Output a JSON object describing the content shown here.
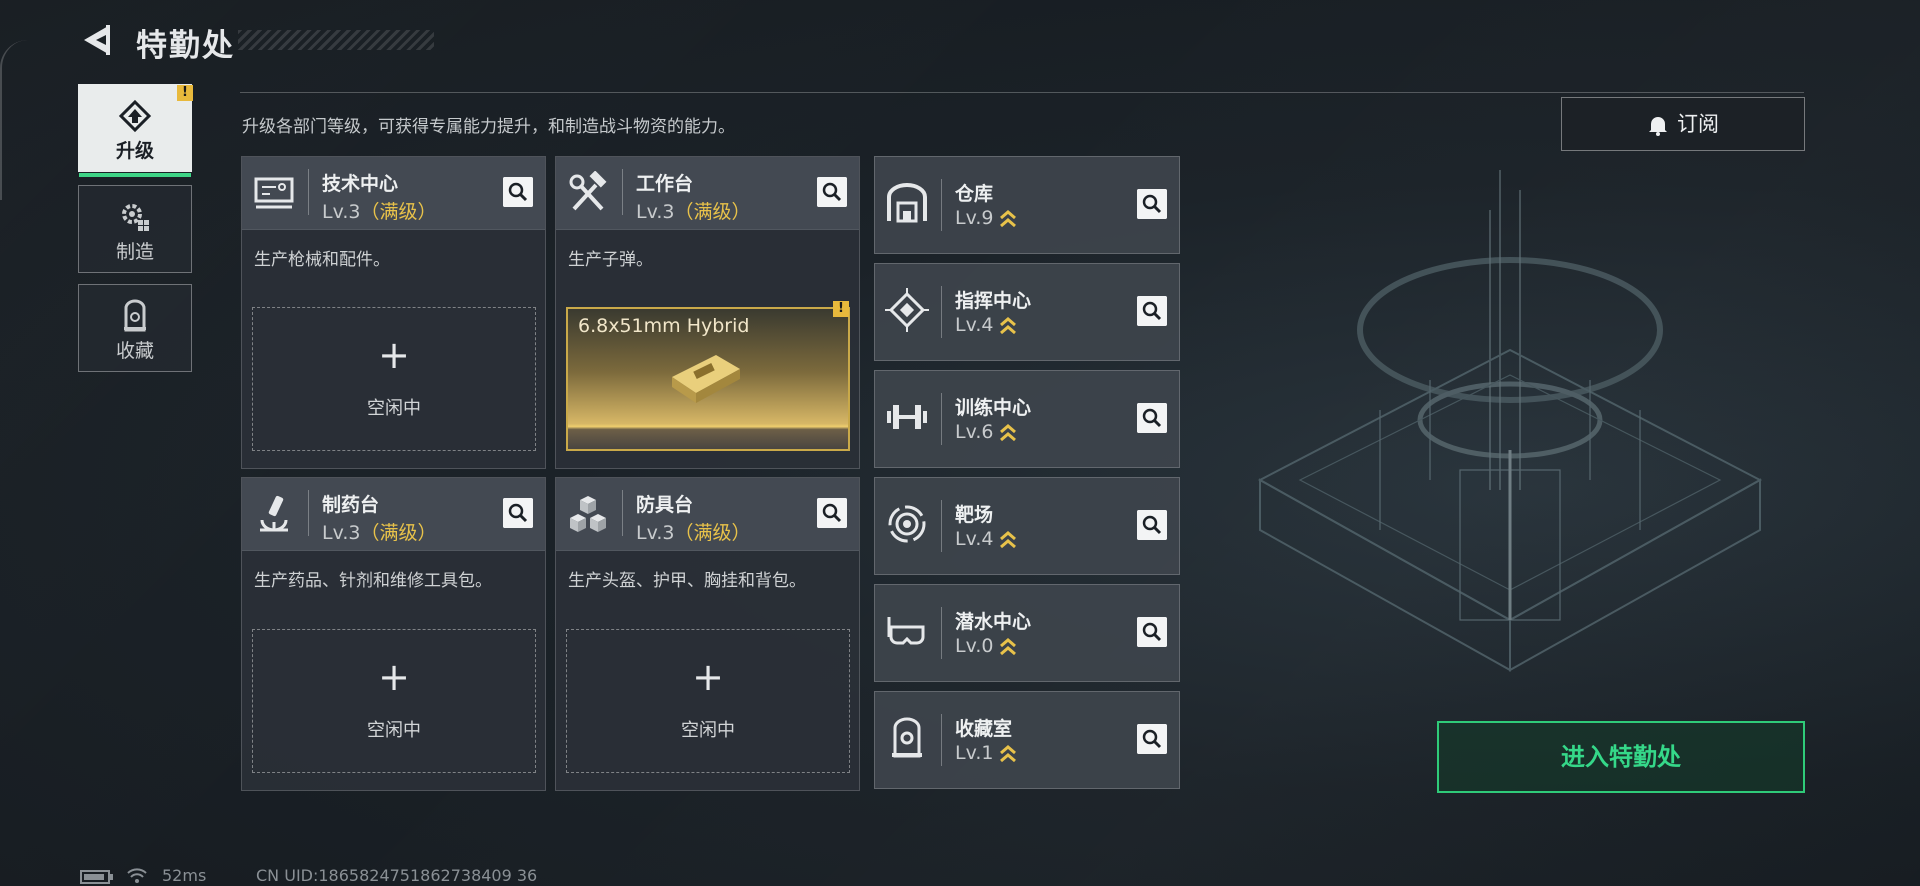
{
  "header": {
    "title": "特勤处"
  },
  "description": "升级各部门等级，可获得专属能力提升，和制造战斗物资的能力。",
  "sidebar": {
    "items": [
      {
        "label": "升级",
        "active": true,
        "icon": "upgrade-icon",
        "warning": "!"
      },
      {
        "label": "制造",
        "active": false,
        "icon": "gear-icon"
      },
      {
        "label": "收藏",
        "active": false,
        "icon": "collection-icon"
      }
    ]
  },
  "departments": [
    {
      "name": "技术中心",
      "level": "Lv.3",
      "max": "（满级）",
      "desc": "生产枪械和配件。",
      "status": "空闲中",
      "icon": "tech-center-icon"
    },
    {
      "name": "工作台",
      "level": "Lv.3",
      "max": "（满级）",
      "desc": "生产子弹。",
      "item": "6.8x51mm Hybrid",
      "warning": "!",
      "icon": "hammer-wrench-icon"
    },
    {
      "name": "制药台",
      "level": "Lv.3",
      "max": "（满级）",
      "desc": "生产药品、针剂和维修工具包。",
      "status": "空闲中",
      "icon": "microscope-icon"
    },
    {
      "name": "防具台",
      "level": "Lv.3",
      "max": "（满级）",
      "desc": "生产头盔、护甲、胸挂和背包。",
      "status": "空闲中",
      "icon": "cubes-icon"
    }
  ],
  "facilities": [
    {
      "name": "仓库",
      "level": "Lv.9",
      "icon": "warehouse-icon"
    },
    {
      "name": "指挥中心",
      "level": "Lv.4",
      "icon": "chip-icon"
    },
    {
      "name": "训练中心",
      "level": "Lv.6",
      "icon": "dumbbell-icon"
    },
    {
      "name": "靶场",
      "level": "Lv.4",
      "icon": "target-icon"
    },
    {
      "name": "潜水中心",
      "level": "Lv.0",
      "icon": "diving-mask-icon"
    },
    {
      "name": "收藏室",
      "level": "Lv.1",
      "icon": "collection-room-icon"
    }
  ],
  "plus": "+",
  "subscribe": {
    "label": "订阅"
  },
  "enter": {
    "label": "进入特勤处"
  },
  "footer": {
    "ping": "52ms",
    "uid": "CN UID:1865824751862738409 36"
  },
  "colors": {
    "accent_green": "#2fcb79",
    "max_gold": "#e8c24a",
    "warning": "#e8b93c"
  }
}
